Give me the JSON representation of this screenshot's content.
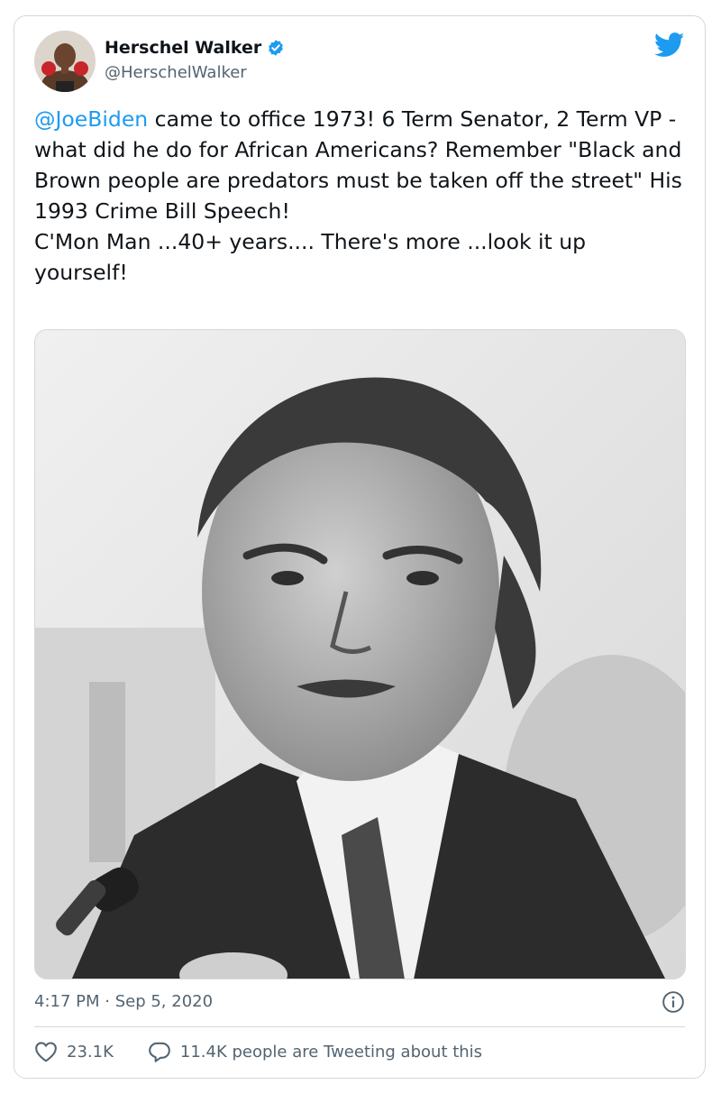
{
  "author": {
    "name": "Herschel Walker",
    "handle": "@HerschelWalker",
    "verified_icon": "verified-badge-icon",
    "avatar_icon": "avatar"
  },
  "tweet": {
    "mention": "@JoeBiden",
    "body": " came to office 1973! 6 Term Senator, 2 Term VP - what did he do for African Americans? Remember \"Black and Brown people are predators must be taken off the street\" His 1993 Crime Bill Speech!\nC'Mon Man ...40+ years.... There's more ...look it up yourself!"
  },
  "meta": {
    "timestamp": "4:17 PM · Sep 5, 2020"
  },
  "engagement": {
    "likes": "23.1K",
    "tweeting": "11.4K people are Tweeting about this"
  },
  "colors": {
    "brand": "#1d9bf0",
    "text": "#0f1419",
    "secondary": "#536471",
    "border": "#cfd9de"
  },
  "icons": [
    "twitter-bird-icon",
    "verified-badge-icon",
    "info-icon",
    "heart-icon",
    "reply-bubble-icon"
  ]
}
